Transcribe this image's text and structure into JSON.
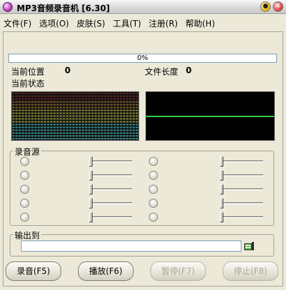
{
  "window": {
    "title": "MP3音频录音机 [6.30]",
    "minimize_glyph": "●",
    "close_glyph": "✕"
  },
  "menu": [
    {
      "label": "文件(F)"
    },
    {
      "label": "选项(O)"
    },
    {
      "label": "皮肤(S)"
    },
    {
      "label": "工具(T)"
    },
    {
      "label": "注册(R)"
    },
    {
      "label": "帮助(H)"
    }
  ],
  "progress": {
    "value": 0,
    "text": "0%"
  },
  "status": {
    "position_label": "当前位置",
    "position_value": "0",
    "length_label": "文件长度",
    "length_value": "0",
    "state_label": "当前状态"
  },
  "visualizer": {
    "scope_line_color": "#2fd24a"
  },
  "recording_source": {
    "title": "录音源",
    "left_column": [
      {
        "slider": 0
      },
      {
        "slider": 0
      },
      {
        "slider": 0
      },
      {
        "slider": 0
      },
      {
        "slider": 0
      }
    ],
    "right_column": [
      {
        "slider": 0
      },
      {
        "slider": 0
      },
      {
        "slider": 0
      },
      {
        "slider": 0
      },
      {
        "slider": 0
      }
    ]
  },
  "output": {
    "title": "输出到",
    "path_value": "",
    "browse_icon": "folder-browse-icon"
  },
  "buttons": {
    "record": "录音(F5)",
    "play": "播放(F6)",
    "pause": "暂停(F7)",
    "stop": "停止(F8)"
  }
}
